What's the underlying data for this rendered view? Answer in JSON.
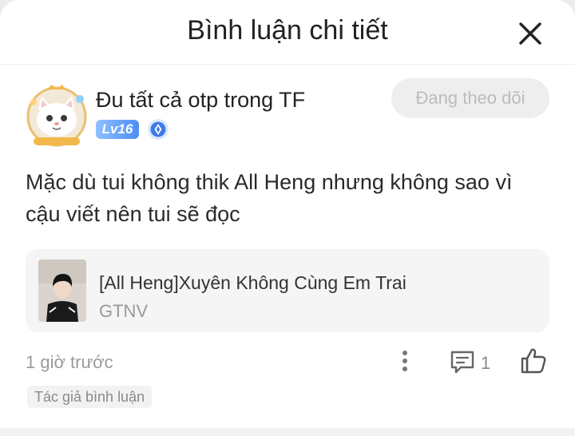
{
  "header": {
    "title": "Bình luận chi tiết",
    "close_icon": "close-icon"
  },
  "comment": {
    "user": {
      "name": "Đu tất cả otp trong TF",
      "level": "Lv16",
      "badge_icon": "verified-badge-icon",
      "avatar": "cat-avatar"
    },
    "follow_label": "Đang theo dõi",
    "text": "Mặc dù tui không thik All Heng nhưng không sao vì cậu viết nên tui sẽ đọc",
    "book": {
      "title": "[All Heng]Xuyên Không Cùng Em Trai",
      "author": "GTNV"
    },
    "time": "1 giờ trước",
    "reply_count": "1",
    "author_tag": "Tác giả bình luận"
  },
  "colors": {
    "level_badge": "#4d8ef5",
    "follow_bg": "#eeeeee",
    "follow_text": "#bcbcbc",
    "book_card_bg": "#f5f5f5"
  }
}
